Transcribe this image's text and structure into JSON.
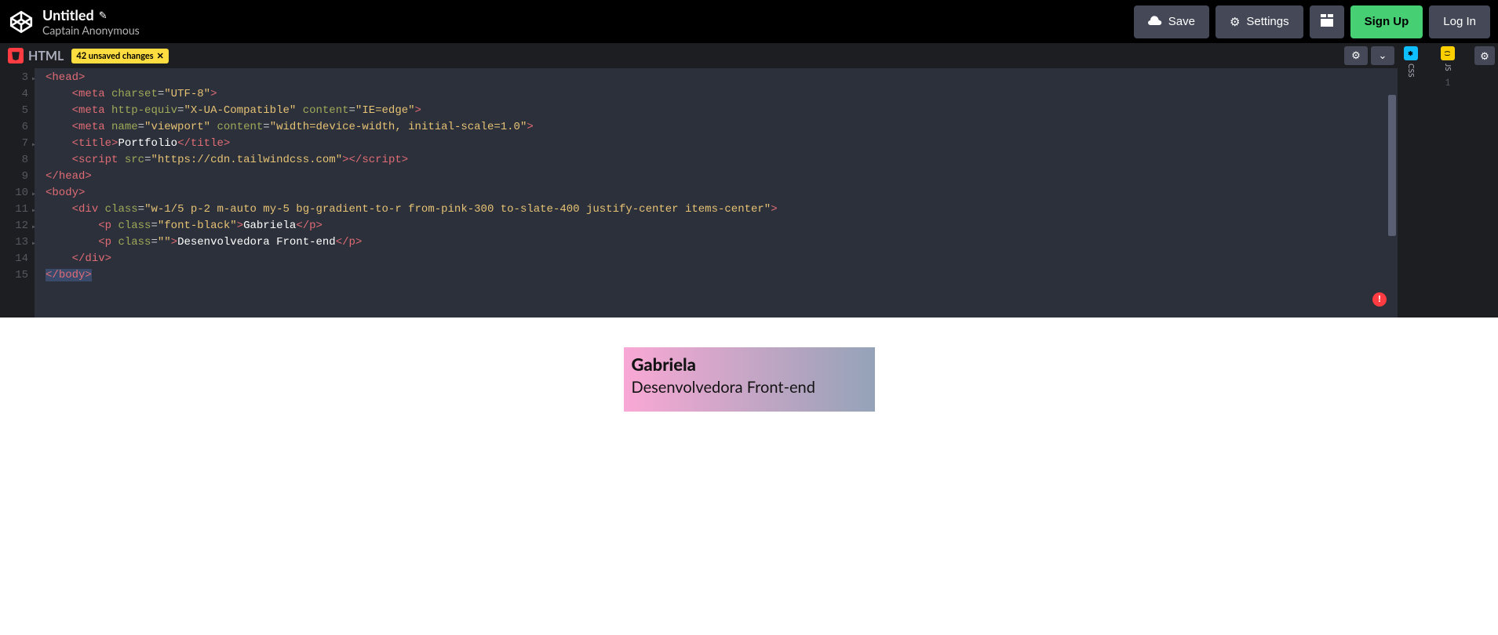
{
  "header": {
    "title": "Untitled",
    "author": "Captain Anonymous",
    "save_label": "Save",
    "settings_label": "Settings",
    "signup_label": "Sign Up",
    "login_label": "Log In"
  },
  "html_panel": {
    "title": "HTML",
    "unsaved_text": "42 unsaved changes",
    "unsaved_x": "✕"
  },
  "collapsed": {
    "css": "CSS",
    "js": "JS",
    "js_line": "1"
  },
  "gutter": [
    "3",
    "4",
    "5",
    "6",
    "7",
    "8",
    "9",
    "10",
    "11",
    "12",
    "13",
    "14",
    "15"
  ],
  "code": {
    "l3": {
      "open": "<",
      "tag": "head",
      "close": ">"
    },
    "l4": {
      "open": "<",
      "tag": "meta",
      "sp": " ",
      "attr": "charset",
      "eq": "=",
      "q": "\"",
      "val": "UTF-8",
      "q2": "\"",
      "close": ">"
    },
    "l5": {
      "open": "<",
      "tag": "meta",
      "sp": " ",
      "attr": "http-equiv",
      "eq": "=",
      "q": "\"",
      "val": "X-UA-Compatible",
      "q2": "\"",
      "sp2": " ",
      "attr2": "content",
      "eq2": "=",
      "q3": "\"",
      "val2": "IE=edge",
      "q4": "\"",
      "close": ">"
    },
    "l6": {
      "open": "<",
      "tag": "meta",
      "sp": " ",
      "attr": "name",
      "eq": "=",
      "q": "\"",
      "val": "viewport",
      "q2": "\"",
      "sp2": " ",
      "attr2": "content",
      "eq2": "=",
      "q3": "\"",
      "val2": "width=device-width, initial-scale=1.0",
      "q4": "\"",
      "close": ">"
    },
    "l7": {
      "open": "<",
      "tag": "title",
      "close": ">",
      "txt": "Portfolio",
      "open2": "</",
      "tag2": "title",
      "close2": ">"
    },
    "l8": {
      "open": "<",
      "tag": "script",
      "sp": " ",
      "attr": "src",
      "eq": "=",
      "q": "\"",
      "val": "https://cdn.tailwindcss.com",
      "q2": "\"",
      "close": ">",
      "open2": "</",
      "tag2": "script",
      "close2": ">"
    },
    "l9": {
      "open": "</",
      "tag": "head",
      "close": ">"
    },
    "l10": {
      "open": "<",
      "tag": "body",
      "close": ">"
    },
    "l11": {
      "open": "<",
      "tag": "div",
      "sp": " ",
      "attr": "class",
      "eq": "=",
      "q": "\"",
      "val": "w-1/5 p-2 m-auto my-5 bg-gradient-to-r from-pink-300 to-slate-400 justify-center items-center",
      "q2": "\"",
      "close": ">"
    },
    "l12": {
      "open": "<",
      "tag": "p",
      "sp": " ",
      "attr": "class",
      "eq": "=",
      "q": "\"",
      "val": "font-black",
      "q2": "\"",
      "close": ">",
      "txt": "Gabriela",
      "open2": "</",
      "tag2": "p",
      "close2": ">"
    },
    "l13": {
      "open": "<",
      "tag": "p",
      "sp": " ",
      "attr": "class",
      "eq": "=",
      "q": "\"",
      "val": "",
      "q2": "\"",
      "close": ">",
      "txt": "Desenvolvedora Front-end",
      "open2": "</",
      "tag2": "p",
      "close2": ">"
    },
    "l14": {
      "open": "</",
      "tag": "div",
      "close": ">"
    },
    "l15": {
      "open": "</",
      "tag": "body",
      "close": ">"
    }
  },
  "preview": {
    "name": "Gabriela",
    "role": "Desenvolvedora Front-end"
  },
  "error_icon": "!"
}
